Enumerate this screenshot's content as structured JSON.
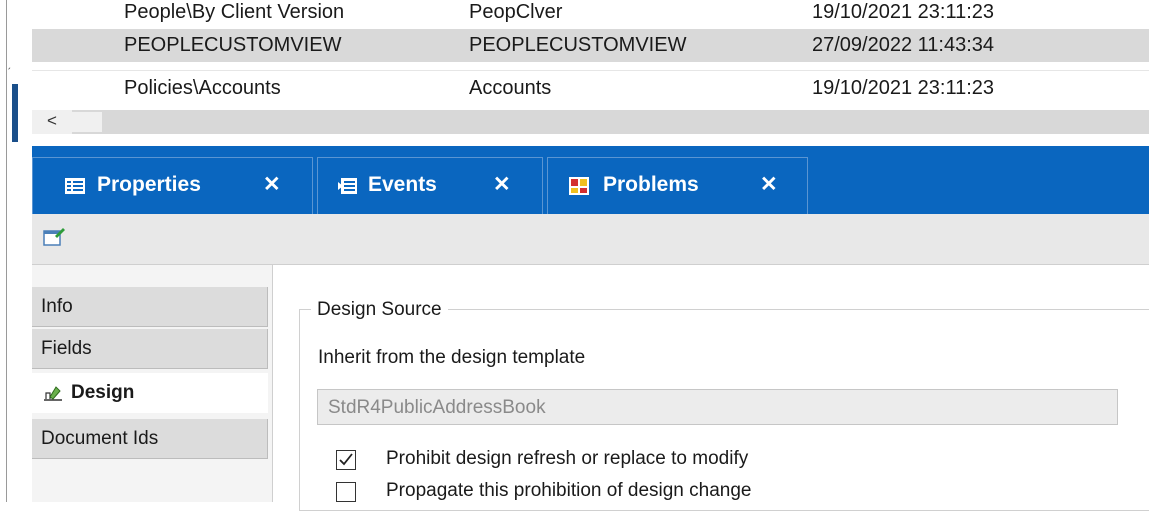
{
  "table": {
    "rows": [
      [
        "People\\By Client Version",
        "PeopClver",
        "19/10/2021 23:11:23"
      ],
      [
        "PEOPLECUSTOMVIEW",
        "PEOPLECUSTOMVIEW",
        "27/09/2022 11:43:34"
      ],
      [
        "Policies\\Accounts",
        "Accounts",
        "19/10/2021 23:11:23"
      ]
    ],
    "selected_row": 1,
    "scroll_left_arrow": "<"
  },
  "tabs": [
    {
      "label": "Properties",
      "icon": "properties-icon",
      "close": "✕"
    },
    {
      "label": "Events",
      "icon": "events-icon",
      "close": "✕"
    },
    {
      "label": "Problems",
      "icon": "problems-icon",
      "close": "✕"
    }
  ],
  "sidenav": {
    "items": [
      {
        "label": "Info",
        "active": false
      },
      {
        "label": "Fields",
        "active": false
      },
      {
        "label": "Design",
        "active": true,
        "icon": "design-icon"
      },
      {
        "label": "Document Ids",
        "active": false
      }
    ]
  },
  "design": {
    "group_title": "Design Source",
    "inherit_label": "Inherit from the design template",
    "template_value": "StdR4PublicAddressBook",
    "checkboxes": [
      {
        "label": "Prohibit design refresh or replace to modify",
        "checked": true
      },
      {
        "label": "Propagate this prohibition of design change",
        "checked": false
      }
    ]
  },
  "colors": {
    "tabbar": "#0a66bf",
    "selected_row": "#d9d9d9"
  }
}
